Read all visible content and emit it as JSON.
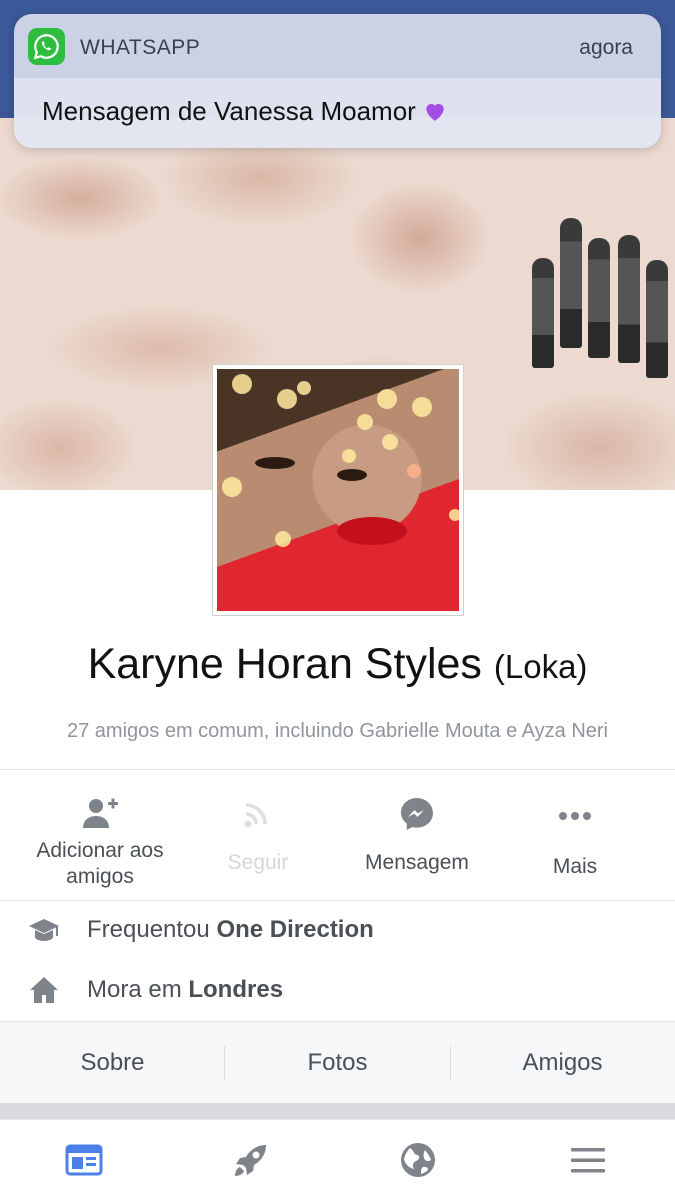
{
  "notification": {
    "app_name": "WHATSAPP",
    "time": "agora",
    "message": "Mensagem de Vanessa Moamor"
  },
  "profile": {
    "name": "Karyne Horan Styles",
    "nickname": "(Loka)",
    "mutual_friends": "27 amigos em comum, incluindo Gabrielle Mouta e Ayza Neri"
  },
  "actions": {
    "add_friend_line1": "Adicionar aos",
    "add_friend_line2": "amigos",
    "follow": "Seguir",
    "message": "Mensagem",
    "more": "Mais"
  },
  "info": {
    "studied_prefix": "Frequentou",
    "studied_value": "One Direction",
    "lives_prefix": "Mora em",
    "lives_value": "Londres"
  },
  "tabs": [
    "Sobre",
    "Fotos",
    "Amigos"
  ],
  "colors": {
    "facebook_blue": "#3b5998",
    "icon_blue": "#4a80e8",
    "icon_gray": "#7f838a",
    "whatsapp_green": "#2fbd3f"
  },
  "bottom_nav_icons": [
    "news-feed-icon",
    "rocket-icon",
    "globe-icon",
    "menu-icon"
  ]
}
